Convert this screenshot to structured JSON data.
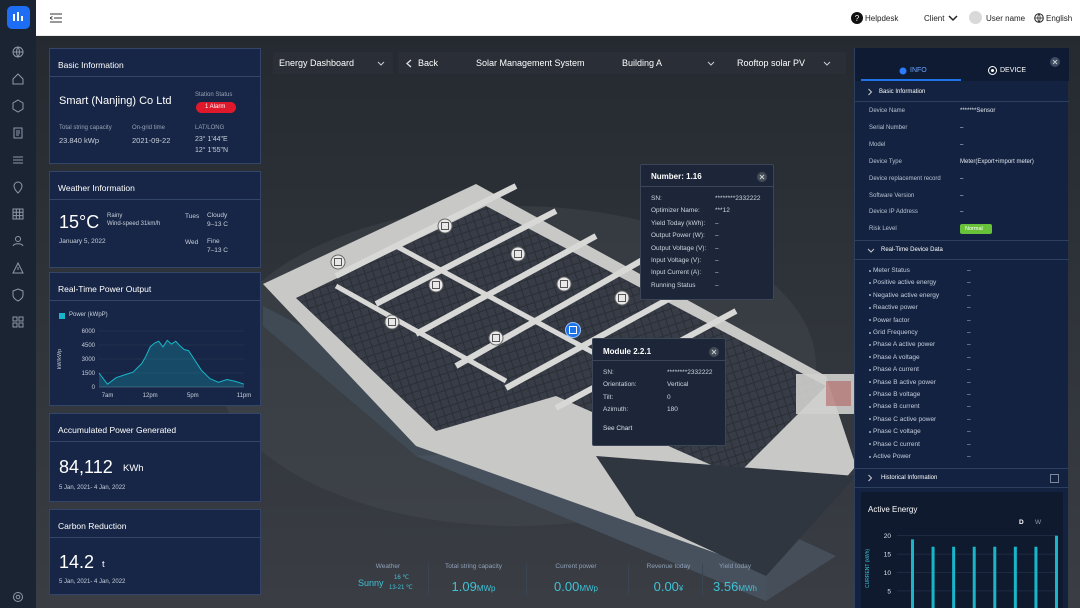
{
  "topbar": {
    "helpdesk": "Helpdesk",
    "client": "Client",
    "user": "User name",
    "language": "English"
  },
  "selectors": {
    "dashboard": "Energy Dashboard",
    "back": "Back",
    "system": "Solar Management System",
    "building": "Building A",
    "site": "Rooftop solar PV"
  },
  "basic": {
    "title": "Basic Information",
    "company": "Smart (Nanjing) Co Ltd",
    "status_label": "Station Status",
    "alarm": "1 Alarm",
    "cap_label": "Total string capacity",
    "cap_value": "23.840 kWp",
    "grid_label": "On-grid time",
    "grid_value": "2021-09-22",
    "latlong_label": "LAT/LONG",
    "lat": "23° 1'44\"E",
    "long": "12° 1'55\"N"
  },
  "weather": {
    "title": "Weather Information",
    "temp": "15°C",
    "cond": "Rainy",
    "wind": "Wind-speed 31km/h",
    "date": "January 5, 2022",
    "d1": "Tues",
    "d1c": "Cloudy",
    "d1t": "9–13  C",
    "d2": "Wed",
    "d2c": "Fine",
    "d2t": "7–13  C"
  },
  "power": {
    "title": "Real-Time Power Output",
    "legend": "Power (kWpP)",
    "ylabel": "kW/kWp"
  },
  "accum": {
    "title": "Accumulated  Power Generated",
    "value": "84,112",
    "unit": "KWh",
    "range": "5 Jan, 2021- 4 Jan, 2022"
  },
  "carbon": {
    "title": "Carbon Reduction",
    "value": "14.2",
    "unit": "t",
    "range": "5 Jan, 2021- 4 Jan, 2022"
  },
  "popup1": {
    "title": "Number: 1.16",
    "rows": [
      {
        "k": "SN:",
        "v": "********2332222"
      },
      {
        "k": "Optimizer Name:",
        "v": "***12"
      },
      {
        "k": "Yield Today (kWh):",
        "v": "–"
      },
      {
        "k": "Output Power (W):",
        "v": "–"
      },
      {
        "k": "Output Voltage (V):",
        "v": "–"
      },
      {
        "k": "Input Voltage (V):",
        "v": "–"
      },
      {
        "k": "Input Current (A):",
        "v": "–"
      },
      {
        "k": "Running Status",
        "v": "–"
      }
    ]
  },
  "popup2": {
    "title": "Module 2.2.1",
    "rows": [
      {
        "k": "SN:",
        "v": "********2332222"
      },
      {
        "k": "Orientation:",
        "v": "Vertical"
      },
      {
        "k": "Tilt:",
        "v": "0"
      },
      {
        "k": "Azimuth:",
        "v": "180"
      }
    ],
    "link": "See Chart"
  },
  "bottom": {
    "weather_label": "Weather",
    "weather_cond": "Sunny",
    "weather_t1": "16 ℃",
    "weather_t2": "13-21 ℃",
    "cap_label": "Total string capacity",
    "cap_value": "1.09",
    "cap_unit": "MWp",
    "power_label": "Current power",
    "power_value": "0.00",
    "power_unit": "MWp",
    "rev_label": "Revenue today",
    "rev_value": "0.00",
    "rev_unit": "¥",
    "yield_label": "Yield today",
    "yield_value": "3.56",
    "yield_unit": "MWh"
  },
  "right": {
    "tab_info": "INFO",
    "tab_device": "DEVICE",
    "basic_title": "Basic Information",
    "fields": [
      {
        "k": "Device Name",
        "v": "*******Sensor"
      },
      {
        "k": "Serial Number",
        "v": "–"
      },
      {
        "k": "Model",
        "v": "–"
      },
      {
        "k": "Device Type",
        "v": "Meter(Export+import meter)"
      },
      {
        "k": "Device replacement record",
        "v": "–"
      },
      {
        "k": "Software Version",
        "v": "–"
      },
      {
        "k": "Device IP Address",
        "v": "–"
      }
    ],
    "risk_label": "Risk Level",
    "risk_value": "Normal",
    "rt_title": "Real-Time Device Data",
    "rt_rows": [
      "Meter Status",
      "Positive active energy",
      "Negative active energy",
      "Reactive power",
      "Power factor",
      "Grid Frequency",
      "Phase A active power",
      "Phase A voltage",
      "Phase A current",
      "Phase B active power",
      "Phase B voltage",
      "Phase B current",
      "Phase C active power",
      "Phase C voltage",
      "Phase C current",
      "Active Power"
    ],
    "rt_value": "–",
    "hist_title": "Historical Information",
    "energy_title": "Active Energy",
    "btn_d": "D",
    "btn_w": "W",
    "energy_ylabel": "CURRENT (kWh)"
  },
  "chart_data": [
    {
      "type": "area",
      "title": "Real-Time Power Output",
      "ylabel": "kW/kWp",
      "series": [
        {
          "name": "Power (kWpP)",
          "color": "#19b6c9"
        }
      ],
      "x_ticks": [
        "7am",
        "12pm",
        "5pm",
        "11pm"
      ],
      "y_ticks": [
        0,
        1500,
        3000,
        4500,
        6000
      ],
      "ylim": [
        0,
        6000
      ],
      "x": [
        6,
        7,
        8,
        9,
        10,
        11,
        11.5,
        12,
        12.5,
        13,
        13.5,
        14,
        14.5,
        15,
        15.5,
        16,
        16.5,
        17,
        17.5,
        18,
        19,
        20,
        21,
        22,
        23
      ],
      "y": [
        1500,
        300,
        1000,
        1300,
        1600,
        2500,
        3300,
        4300,
        4700,
        4900,
        4300,
        5000,
        4600,
        4900,
        4400,
        4000,
        3900,
        3200,
        2500,
        1800,
        900,
        500,
        800,
        600,
        300
      ]
    },
    {
      "type": "bar",
      "title": "Active Energy",
      "ylabel": "CURRENT (kWh)",
      "y_ticks": [
        5,
        10,
        15,
        20
      ],
      "ylim": [
        2,
        21
      ],
      "values": [
        19,
        17,
        17,
        17,
        17,
        17,
        17,
        20
      ]
    }
  ]
}
